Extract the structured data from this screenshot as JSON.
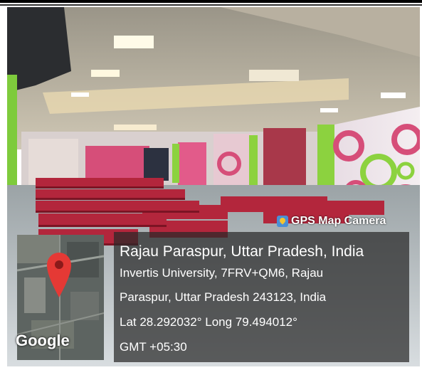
{
  "photo": {
    "subject": "auditorium-with-red-seats"
  },
  "stamp": {
    "brand": "GPS Map Camera",
    "brand_icon": "gps-map-camera-icon",
    "title": "Rajau Paraspur, Uttar Pradesh, India",
    "address_line1": "Invertis University, 7FRV+QM6, Rajau",
    "address_line2": "Paraspur, Uttar Pradesh 243123, India",
    "coords": "Lat 28.292032° Long 79.494012°",
    "timezone": "GMT +05:30",
    "map_logo": "Google",
    "pin_color": "#e53935"
  }
}
